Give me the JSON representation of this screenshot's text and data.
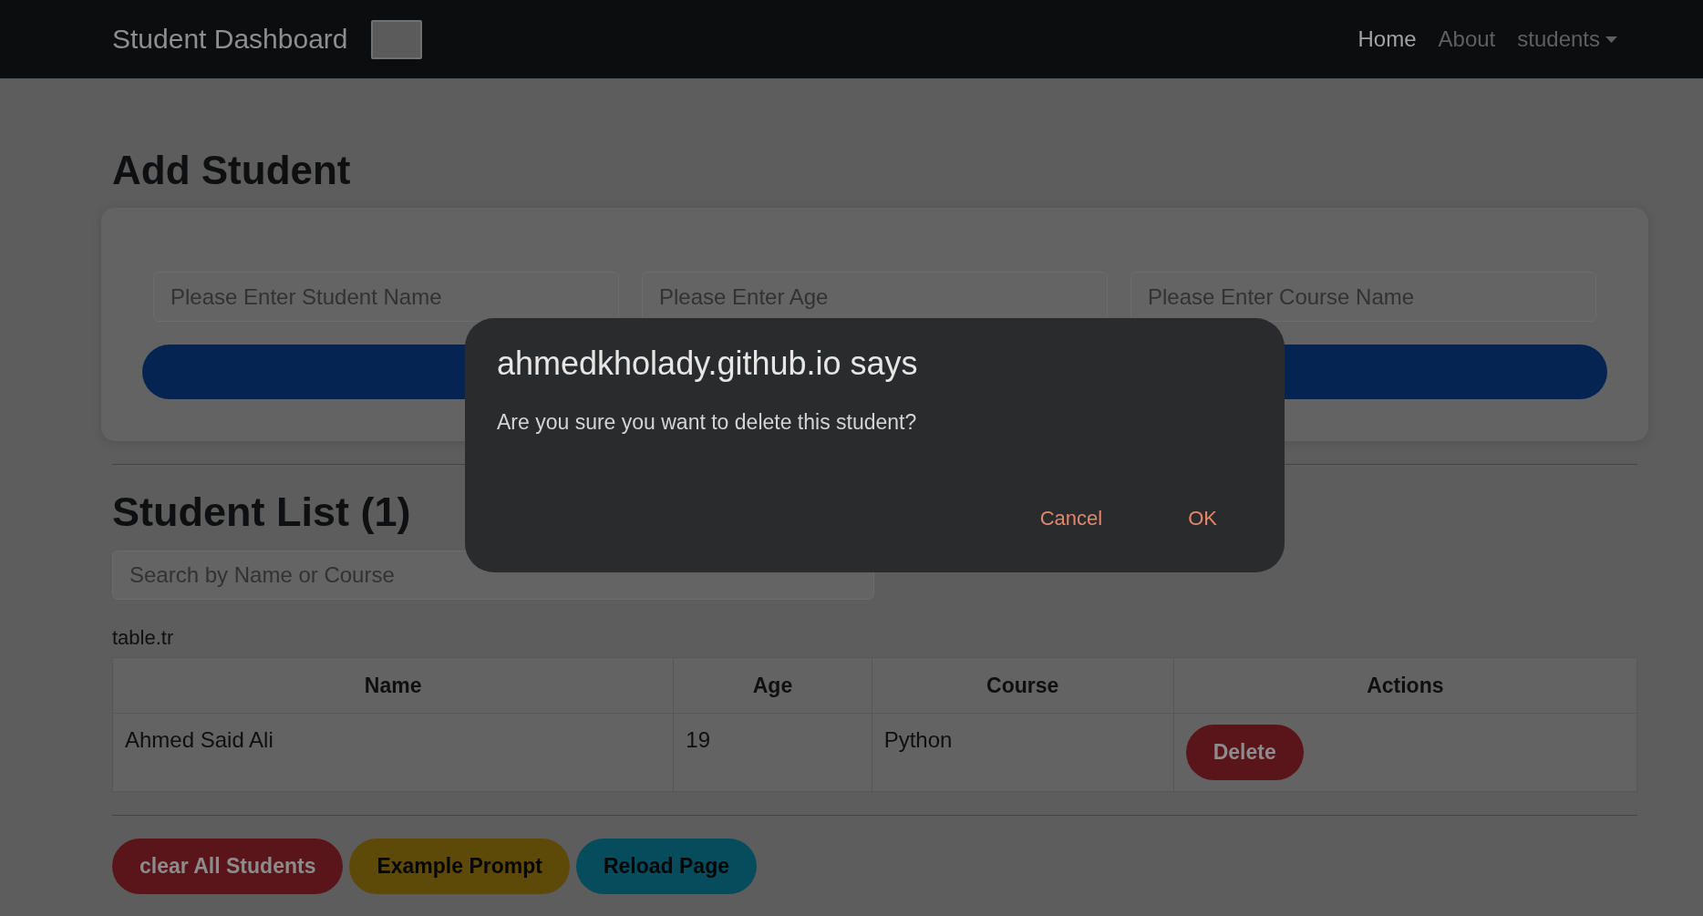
{
  "navbar": {
    "brand": "Student Dashboard",
    "links": [
      {
        "label": "Home",
        "selected": true,
        "kind": "link"
      },
      {
        "label": "About",
        "selected": false,
        "kind": "link"
      },
      {
        "label": "students",
        "selected": false,
        "kind": "dropdown"
      }
    ]
  },
  "add_student": {
    "heading": "Add Student",
    "fields": [
      {
        "placeholder": "Please Enter Student Name"
      },
      {
        "placeholder": "Please Enter Age"
      },
      {
        "placeholder": "Please Enter Course Name"
      }
    ]
  },
  "student_list": {
    "heading": "Student List (1)",
    "search": {
      "placeholder": "Search by Name or Course"
    },
    "caption": "table.tr",
    "table": {
      "columns": [
        "Name",
        "Age",
        "Course",
        "Actions"
      ],
      "rows": [
        {
          "cells": [
            "Ahmed Said Ali",
            "19",
            "Python"
          ],
          "action": "Delete"
        }
      ]
    }
  },
  "footer_buttons": [
    {
      "label": "clear All Students",
      "color": "#5a151b"
    },
    {
      "label": "Example Prompt",
      "color": "#5e4a08"
    },
    {
      "label": "Reload Page",
      "color": "#064c5c"
    }
  ],
  "dialog": {
    "title": "ahmedkholady.github.io says",
    "message": "Are you sure you want to delete this student?",
    "buttons": [
      "Cancel",
      "OK"
    ]
  }
}
